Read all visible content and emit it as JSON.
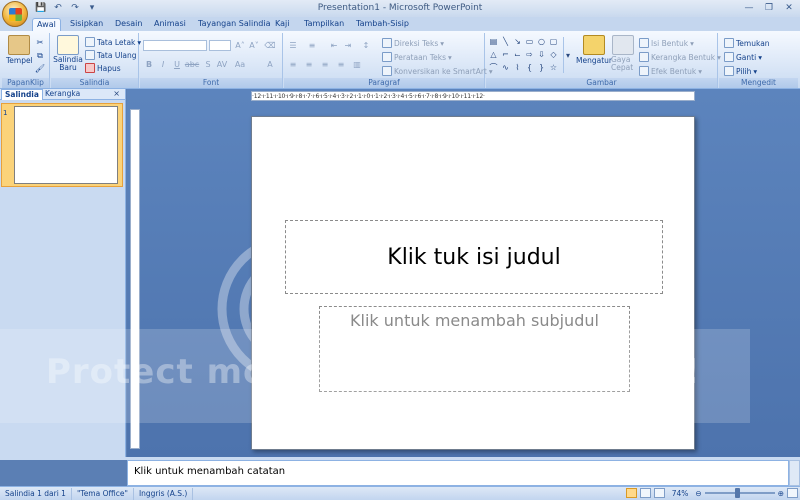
{
  "window": {
    "title": "Presentation1 - Microsoft PowerPoint"
  },
  "tabs": [
    {
      "label": "Awal",
      "active": true
    },
    {
      "label": "Sisipkan"
    },
    {
      "label": "Desain"
    },
    {
      "label": "Animasi"
    },
    {
      "label": "Tayangan Salindia"
    },
    {
      "label": "Kaji"
    },
    {
      "label": "Tampilkan"
    },
    {
      "label": "Tambah-Sisip"
    }
  ],
  "ribbon": {
    "clipboard": {
      "label": "PapanKlip",
      "paste": "Tempel"
    },
    "slides": {
      "label": "Salindia",
      "new_slide": "Salindia Baru",
      "layout": "Tata Letak",
      "reset": "Tata Ulang",
      "delete": "Hapus"
    },
    "font": {
      "label": "Font"
    },
    "paragraph": {
      "label": "Paragraf",
      "text_direction": "Direksi Teks",
      "align_text": "Perataan Teks",
      "smartart": "Konversikan ke SmartArt"
    },
    "drawing": {
      "label": "Gambar",
      "arrange": "Mengatur",
      "quick_styles": "Gaya Cepat",
      "shape_fill": "Isi Bentuk",
      "shape_outline": "Kerangka Bentuk",
      "shape_effects": "Efek Bentuk"
    },
    "editing": {
      "label": "Mengedit",
      "find": "Temukan",
      "replace": "Ganti",
      "select": "Pilih"
    }
  },
  "left_pane": {
    "tab_slides": "Salindia",
    "tab_outline": "Kerangka",
    "close": "×",
    "slide_number": "1"
  },
  "ruler": {
    "horizontal": "·12·ı·11·ı·10·ı·9·ı·8·ı·7·ı·6·ı·5·ı·4·ı·3·ı·2·ı·1·ı·0·ı·1·ı·2·ı·3·ı·4·ı·5·ı·6·ı·7·ı·8·ı·9·ı·10·ı·11·ı·12·"
  },
  "slide": {
    "title_placeholder": "Klik tuk isi judul",
    "subtitle_placeholder": "Klik untuk menambah subjudul"
  },
  "watermark": {
    "text": "Protect more",
    "suffix": "!"
  },
  "notes": {
    "placeholder": "Klik untuk menambah catatan"
  },
  "status": {
    "slide_info": "Salindia 1 dari 1",
    "theme": "\"Tema Office\"",
    "language": "Inggris (A.S.)",
    "zoom": "74%"
  }
}
